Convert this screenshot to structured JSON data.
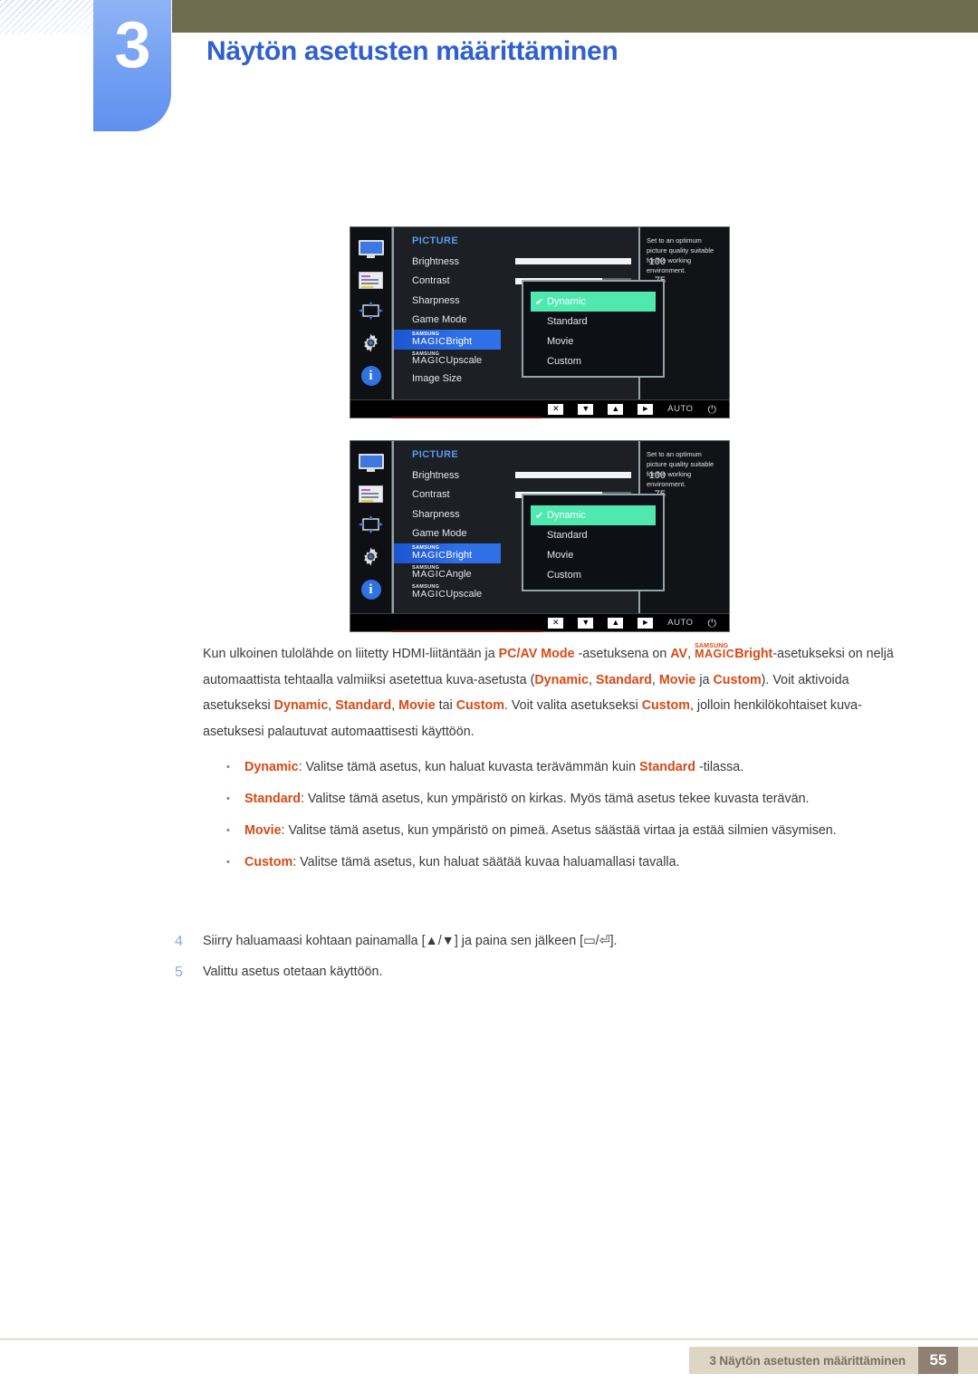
{
  "header": {
    "chapter_number": "3",
    "chapter_title": "Näytön asetusten määrittäminen"
  },
  "osd_panels": [
    {
      "menu_title": "PICTURE",
      "rail_icons": [
        "monitor-icon",
        "osd-list-icon",
        "move-arrows-icon",
        "gear-icon",
        "info-icon"
      ],
      "items": [
        {
          "label": "Brightness",
          "type": "slider",
          "value": "100",
          "fill": 100
        },
        {
          "label": "Contrast",
          "type": "slider",
          "value": "75",
          "fill": 75
        },
        {
          "label": "Sharpness",
          "type": "plain"
        },
        {
          "label": "Game Mode",
          "type": "plain"
        },
        {
          "label": "Bright",
          "type": "magic",
          "selected": true
        },
        {
          "label": "Upscale",
          "type": "magic"
        },
        {
          "label": "Image Size",
          "type": "plain"
        }
      ],
      "magic_prefix_top": "SAMSUNG",
      "magic_prefix_bottom": "MAGIC",
      "dropdown": {
        "options": [
          "Dynamic",
          "Standard",
          "Movie",
          "Custom"
        ],
        "selected": "Dynamic",
        "check_glyph": "✔"
      },
      "help_text": "Set to an optimum picture quality suitable for the working environment.",
      "footer_buttons": [
        "✕",
        "▼",
        "▲",
        "►",
        "AUTO",
        "⏻"
      ]
    },
    {
      "menu_title": "PICTURE",
      "rail_icons": [
        "monitor-icon",
        "osd-list-icon",
        "move-arrows-icon",
        "gear-icon",
        "info-icon"
      ],
      "items": [
        {
          "label": "Brightness",
          "type": "slider",
          "value": "100",
          "fill": 100
        },
        {
          "label": "Contrast",
          "type": "slider",
          "value": "75",
          "fill": 75
        },
        {
          "label": "Sharpness",
          "type": "plain"
        },
        {
          "label": "Game Mode",
          "type": "plain"
        },
        {
          "label": "Bright",
          "type": "magic",
          "selected": true
        },
        {
          "label": "Angle",
          "type": "magic"
        },
        {
          "label": "Upscale",
          "type": "magic"
        }
      ],
      "magic_prefix_top": "SAMSUNG",
      "magic_prefix_bottom": "MAGIC",
      "dropdown": {
        "options": [
          "Dynamic",
          "Standard",
          "Movie",
          "Custom"
        ],
        "selected": "Dynamic",
        "check_glyph": "✔"
      },
      "help_text": "Set to an optimum picture quality suitable for the working environment.",
      "footer_buttons": [
        "✕",
        "▼",
        "▲",
        "►",
        "AUTO",
        "⏻"
      ]
    }
  ],
  "paragraph": {
    "p1_a": "Kun ulkoinen tulolähde on liitetty HDMI-liitäntään ja ",
    "p1_hl1": "PC/AV Mode",
    "p1_b": " -asetuksena on ",
    "p1_hl2": "AV",
    "p1_c": ", ",
    "p1_magic_top": "SAMSUNG",
    "p1_magic_bottom": "MAGIC",
    "p1_magic_suffix": "Bright",
    "p1_d": "-asetukseksi on neljä automaattista tehtaalla valmiiksi asetettua kuva-asetusta (",
    "p1_hl3": "Dynamic",
    "p1_e": ", ",
    "p1_hl4": "Standard",
    "p1_f": ", ",
    "p1_hl5": "Movie",
    "p1_g": " ja ",
    "p1_hl6": "Custom",
    "p1_h": "). Voit aktivoida asetukseksi ",
    "p1_hl7": "Dynamic",
    "p1_i": ", ",
    "p1_hl8": "Standard",
    "p1_j": ", ",
    "p1_hl9": "Movie",
    "p1_k": " tai ",
    "p1_hl10": "Custom",
    "p1_l": ". Voit valita asetukseksi ",
    "p1_hl11": "Custom",
    "p1_m": ", jolloin henkilökohtaiset kuva-asetuksesi palautuvat automaattisesti käyttöön."
  },
  "bullets": [
    {
      "term": "Dynamic",
      "text_a": ": Valitse tämä asetus, kun haluat kuvasta terävämmän kuin ",
      "hl": "Standard",
      "text_b": " -tilassa."
    },
    {
      "term": "Standard",
      "text_a": ": Valitse tämä asetus, kun ympäristö on kirkas. Myös tämä asetus tekee kuvasta terävän.",
      "hl": "",
      "text_b": ""
    },
    {
      "term": "Movie",
      "text_a": ": Valitse tämä asetus, kun ympäristö on pimeä. Asetus säästää virtaa ja estää silmien väsymisen.",
      "hl": "",
      "text_b": ""
    },
    {
      "term": "Custom",
      "text_a": ": Valitse tämä asetus, kun haluat säätää kuvaa haluamallasi tavalla.",
      "hl": "",
      "text_b": ""
    }
  ],
  "steps": [
    {
      "number": "4",
      "text": "Siirry haluamaasi kohtaan painamalla [▲/▼] ja paina sen jälkeen [▭/⏎]."
    },
    {
      "number": "5",
      "text": "Valittu asetus otetaan käyttöön."
    }
  ],
  "footer": {
    "text": "3 Näytön asetusten määrittäminen",
    "page": "55"
  },
  "colors": {
    "chapter_blue": "#6f9df2",
    "title_blue": "#2f5fd0",
    "olive": "#6e6b51",
    "highlight_orange": "#d94a16",
    "osd_select_blue": "#2f6fe8",
    "osd_active_green": "#4fe9b0",
    "footer_beige": "#ddd6c4",
    "footer_page_brown": "#8e8173"
  }
}
